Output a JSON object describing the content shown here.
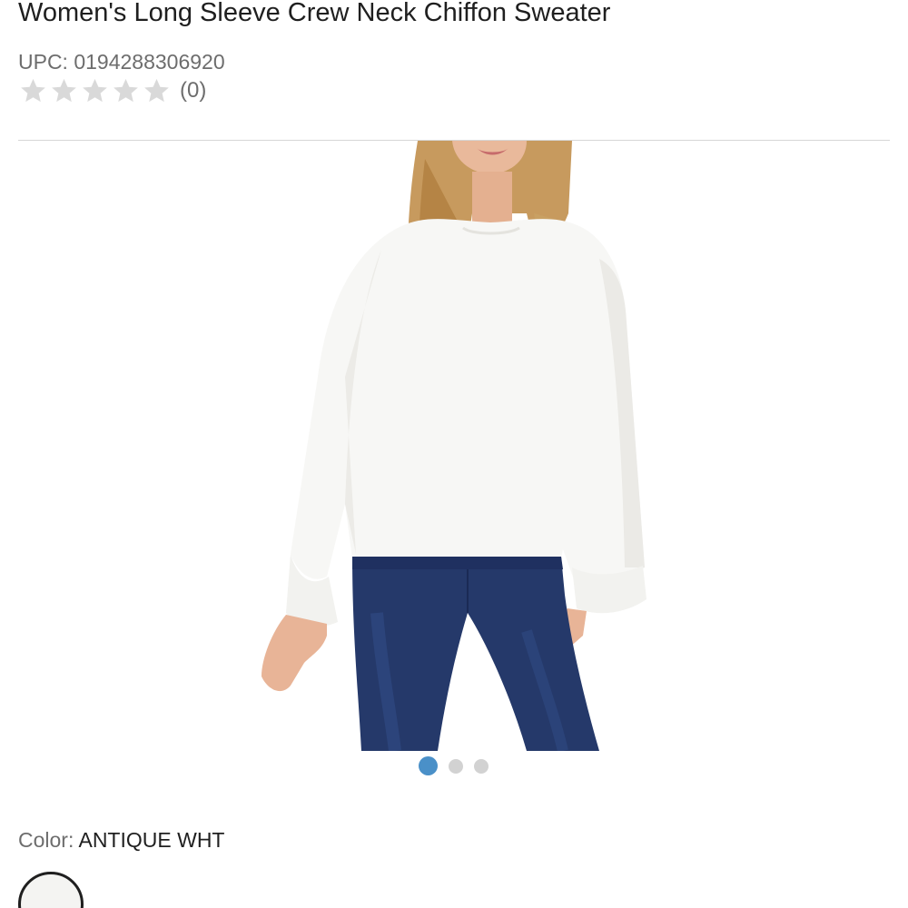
{
  "product": {
    "title": "Women's Long Sleeve Crew Neck Chiffon Sweater",
    "upc_label": "UPC:",
    "upc_value": "0194288306920",
    "rating": {
      "stars_filled": 0,
      "stars_total": 5,
      "review_count": "(0)",
      "star_color": "#d9d9d9"
    }
  },
  "gallery": {
    "image_icon": "product-photo",
    "current_index": 1,
    "total": 3,
    "active_dot_color": "#4a90c8",
    "inactive_dot_color": "#d2d2d2"
  },
  "color": {
    "label": "Color:",
    "value": "ANTIQUE WHT",
    "swatch_color": "#f4f4f2"
  }
}
